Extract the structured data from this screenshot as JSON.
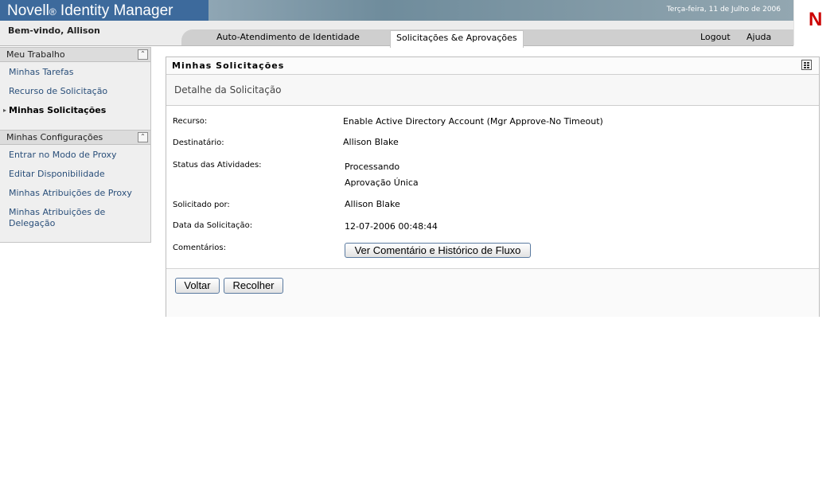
{
  "app": {
    "brand": "Novell",
    "brand_reg": "®",
    "brand_product": " Identity Manager",
    "date": "Terça-feira, 11 de Julho de 2006",
    "logo": "N"
  },
  "header": {
    "welcome": "Bem-vindo, Allison",
    "tabs": [
      {
        "label": "Auto-Atendimento de Identidade"
      },
      {
        "label": "Solicitações &e Aprovações"
      }
    ],
    "links": {
      "logout": "Logout",
      "help": "Ajuda"
    }
  },
  "sidebar": {
    "work": {
      "title": "Meu Trabalho",
      "items": [
        {
          "label": "Minhas Tarefas"
        },
        {
          "label": "Recurso de Solicitação"
        },
        {
          "label": "Minhas Solicitações"
        }
      ]
    },
    "settings": {
      "title": "Minhas Configurações",
      "items": [
        {
          "label": "Entrar no Modo de Proxy"
        },
        {
          "label": "Editar Disponibilidade"
        },
        {
          "label": "Minhas Atribuições de Proxy"
        },
        {
          "label": "Minhas Atribuições de Delegação"
        }
      ]
    }
  },
  "main": {
    "title": "Minhas Solicitações",
    "subtitle": "Detalhe da Solicitação",
    "fields": {
      "resource_label": "Recurso:",
      "resource_value": "Enable Active Directory Account (Mgr Approve-No Timeout)",
      "recipient_label": "Destinatário:",
      "recipient_value": "Allison Blake",
      "status_label": "Status das Atividades:",
      "status_value_1": "Processando",
      "status_value_2": "Aprovação Única",
      "requested_by_label": "Solicitado por:",
      "requested_by_value": "Allison Blake",
      "date_label": "Data da Solicitação:",
      "date_value": "12-07-2006 00:48:44",
      "comments_label": "Comentários:",
      "comments_button": "Ver Comentário e Histórico de Fluxo"
    },
    "buttons": {
      "back": "Voltar",
      "collapse": "Recolher"
    }
  }
}
